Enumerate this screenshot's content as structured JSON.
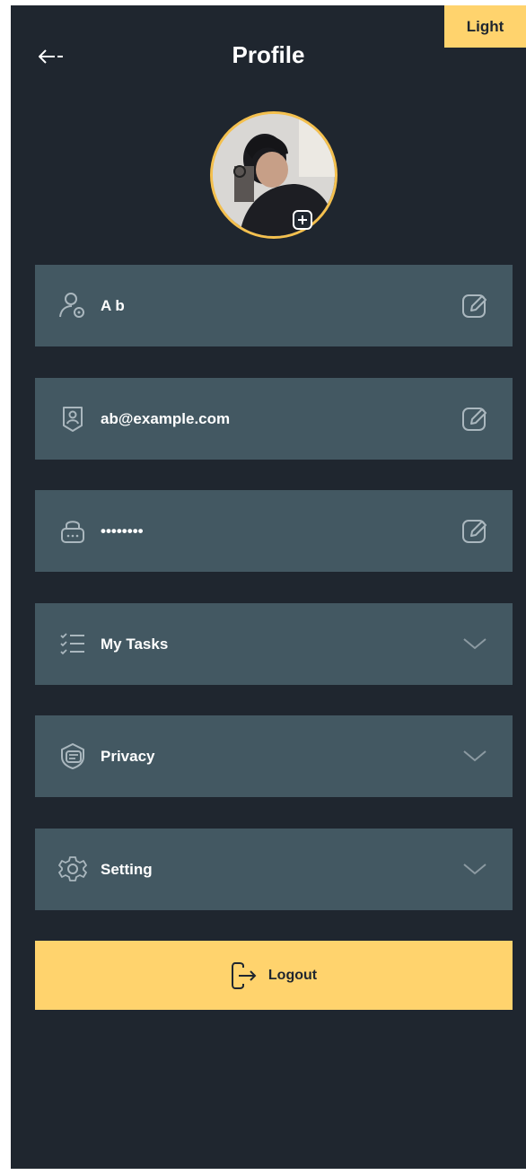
{
  "theme_toggle": {
    "label": "Light"
  },
  "header": {
    "title": "Profile"
  },
  "profile_fields": [
    {
      "label": "A b",
      "icon": "user-icon",
      "action_icon": "edit-icon"
    },
    {
      "label": "ab@example.com",
      "icon": "id-badge-icon",
      "action_icon": "edit-icon"
    },
    {
      "label": "••••••••",
      "icon": "lock-icon",
      "action_icon": "edit-icon"
    }
  ],
  "sections": [
    {
      "label": "My Tasks",
      "icon": "tasks-icon",
      "action_icon": "chevron-down-icon"
    },
    {
      "label": "Privacy",
      "icon": "privacy-icon",
      "action_icon": "chevron-down-icon"
    },
    {
      "label": "Setting",
      "icon": "gear-icon",
      "action_icon": "chevron-down-icon"
    }
  ],
  "logout": {
    "label": "Logout",
    "icon": "logout-icon"
  },
  "colors": {
    "background": "#1f262f",
    "card": "#435862",
    "accent": "#ffd36d",
    "icon": "#aab7be",
    "text": "#ffffff"
  }
}
